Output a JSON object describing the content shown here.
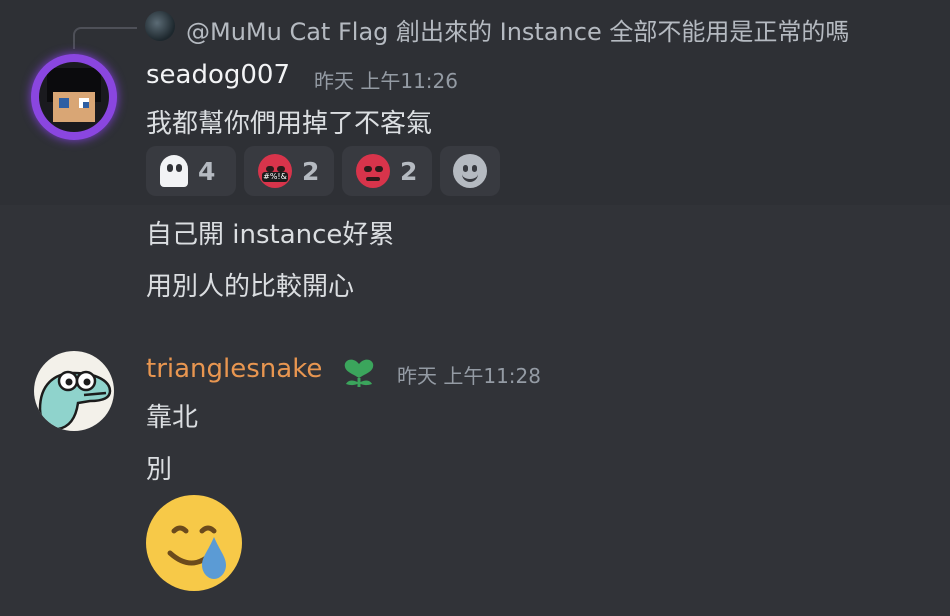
{
  "reply": {
    "text": "@MuMu Cat Flag 創出來的 Instance 全部不能用是正常的嗎"
  },
  "message1": {
    "author": "seadog007",
    "timestamp": "昨天 上午11:26",
    "lines": [
      "我都幫你們用掉了不客氣"
    ],
    "reactions": [
      {
        "emoji": "ghost-icon",
        "count": "4"
      },
      {
        "emoji": "face-with-symbols-on-mouth-icon",
        "count": "2"
      },
      {
        "emoji": "angry-face-icon",
        "count": "2"
      },
      {
        "emoji": "add-reaction-icon",
        "count": ""
      }
    ],
    "followups": [
      "自己開 instance好累",
      "用別人的比較開心"
    ]
  },
  "message2": {
    "author": "trianglesnake",
    "timestamp": "昨天 上午11:28",
    "lines": [
      "靠北",
      "別"
    ],
    "big_emoji": "smiling-face-with-tear-icon"
  },
  "colors": {
    "background": "#313338",
    "username2": "#e89650",
    "avatar_ring": "#8a46e0"
  }
}
